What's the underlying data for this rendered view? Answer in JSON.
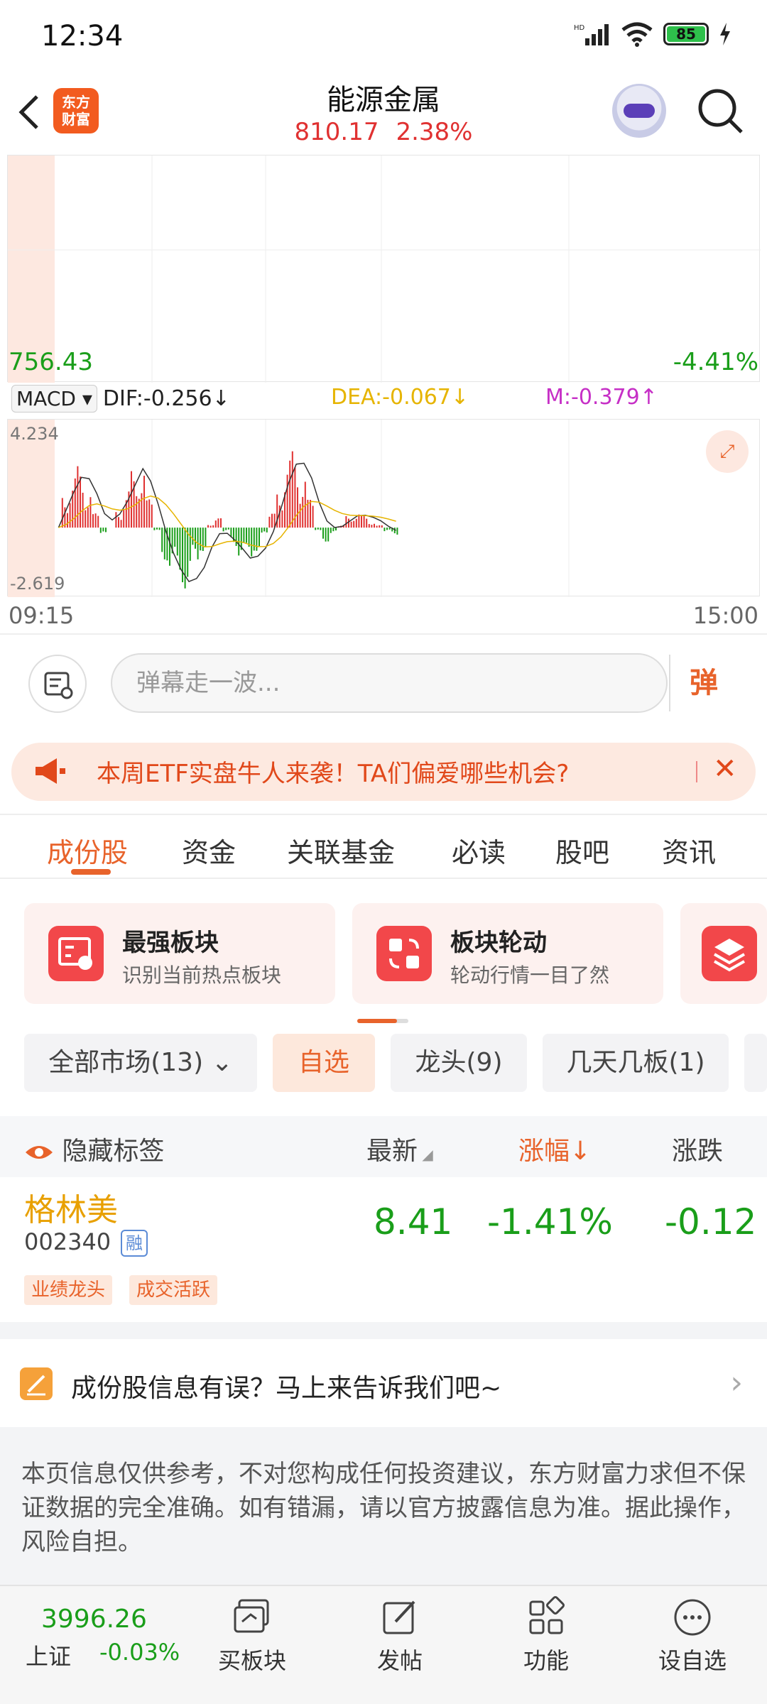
{
  "status": {
    "time": "12:34",
    "battery": "85"
  },
  "header": {
    "logo": "东方财富",
    "title": "能源金属",
    "price": "810.17",
    "change_pct": "2.38%"
  },
  "chart": {
    "price_low": "756.43",
    "pct_low": "-4.41%",
    "macd_label": "MACD",
    "dif": "DIF:-0.256↓",
    "dea": "DEA:-0.067↓",
    "m": "M:-0.379↑",
    "macd_high": "4.234",
    "macd_low": "-2.619",
    "time_start": "09:15",
    "time_end": "15:00",
    "colors": {
      "up": "#e03131",
      "down": "#1a9e1a",
      "dif": "#333333",
      "dea": "#e6b400"
    }
  },
  "chart_data": {
    "type": "bar",
    "title": "",
    "series": [
      {
        "name": "MACD",
        "values": [
          0.0,
          1.5,
          2.2,
          2.6,
          1.8,
          0.6,
          -0.4,
          0.0,
          0.8,
          1.6,
          2.4,
          3.0,
          1.2,
          -0.2,
          -1.4,
          -2.0,
          -2.4,
          -2.6,
          -1.8,
          -1.0,
          0.2,
          0.4,
          -0.2,
          -0.8,
          -1.2,
          -1.6,
          -1.0,
          -0.4,
          0.6,
          1.8,
          2.9,
          3.3,
          2.5,
          1.2,
          -0.2,
          -0.6,
          -0.3,
          0.1,
          0.5,
          0.7,
          0.5,
          0.3,
          0.1,
          -0.2,
          -0.3
        ]
      }
    ],
    "ylim": [
      -2.619,
      4.234
    ],
    "x_range": [
      "09:15",
      "15:00"
    ],
    "xlabel": "",
    "ylabel": "",
    "grid": true
  },
  "danmu": {
    "placeholder": "弹幕走一波...",
    "send": "弹"
  },
  "banner": {
    "text": "本周ETF实盘牛人来袭！TA们偏爱哪些机会?",
    "close": "✕"
  },
  "tabs": [
    "成份股",
    "资金",
    "关联基金",
    "必读",
    "股吧",
    "资讯"
  ],
  "cards": [
    {
      "title": "最强板块",
      "sub": "识别当前热点板块"
    },
    {
      "title": "板块轮动",
      "sub": "轮动行情一目了然"
    }
  ],
  "filters": [
    "全部市场(13)",
    "自选",
    "龙头(9)",
    "几天几板(1)"
  ],
  "table": {
    "hide_tags": "隐藏标签",
    "col_latest": "最新",
    "col_change": "涨幅",
    "col_diff": "涨跌"
  },
  "stock": {
    "name": "格林美",
    "code": "002340",
    "badge": "融",
    "tags": [
      "业绩龙头",
      "成交活跃"
    ],
    "latest": "8.41",
    "change": "-1.41%",
    "diff": "-0.12"
  },
  "feedback": "成份股信息有误？马上来告诉我们吧~",
  "disclaimer": "本页信息仅供参考，不对您构成任何投资建议，东方财富力求但不保证数据的完全准确。如有错漏，请以官方披露信息为准。据此操作，风险自担。",
  "bottom": {
    "index_value": "3996.26",
    "index_name": "上证",
    "index_change": "-0.03%",
    "nav": [
      "买板块",
      "发帖",
      "功能",
      "设自选"
    ]
  }
}
